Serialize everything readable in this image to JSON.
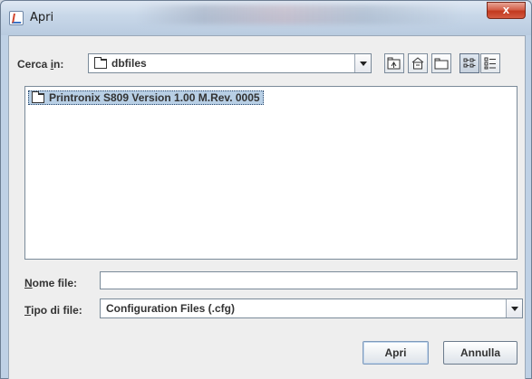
{
  "window": {
    "title": "Apri",
    "close_label": "x"
  },
  "look_in": {
    "label_pre": "Cerca ",
    "label_u": "i",
    "label_post": "n:",
    "value": "dbfiles"
  },
  "toolbar": {
    "icons": [
      "up-folder-icon",
      "home-icon",
      "new-folder-icon",
      "list-view-icon",
      "details-view-icon"
    ],
    "selected": "list-view-icon"
  },
  "files": [
    {
      "name": "Printronix S809 Version  1.00 M.Rev. 0005",
      "selected": true
    }
  ],
  "file_name": {
    "label_u": "N",
    "label_post": "ome file:",
    "value": ""
  },
  "file_type": {
    "label_u": "T",
    "label_post": "ipo di file:",
    "value": "Configuration Files (.cfg)"
  },
  "buttons": {
    "open": "Apri",
    "cancel": "Annulla"
  }
}
